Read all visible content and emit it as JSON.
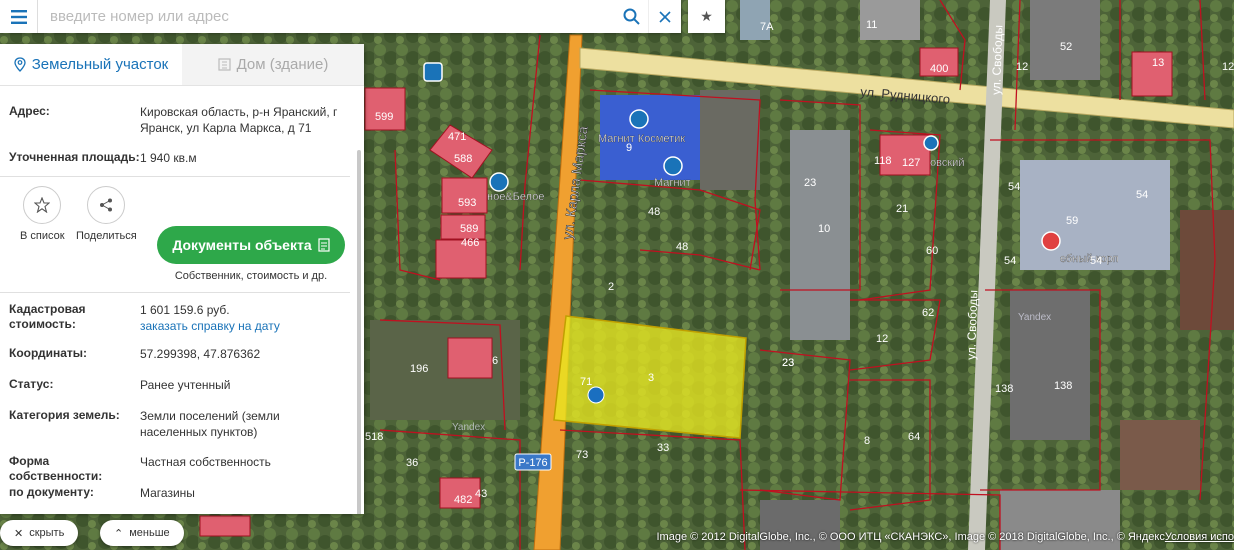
{
  "search": {
    "placeholder": "введите номер или адрес"
  },
  "tabs": [
    {
      "label": "Земельный участок",
      "icon": "map-pin-icon",
      "active": true
    },
    {
      "label": "Дом (здание)",
      "icon": "building-icon",
      "active": false
    }
  ],
  "info": {
    "address_label": "Адрес:",
    "address_value": "Кировская область, р-н Яранский, г Яранск, ул Карла Маркса, д 71",
    "area_label": "Уточненная площадь:",
    "area_value": "1 940 кв.м",
    "cost_label": "Кадастровая стоимость:",
    "cost_value": "1 601 159.6 руб.",
    "cost_link": "заказать справку на дату",
    "coords_label": "Координаты:",
    "coords_value": "57.299398, 47.876362",
    "status_label": "Статус:",
    "status_value": "Ранее учтенный",
    "category_label": "Категория земель:",
    "category_value": "Земли поселений (земли населенных пунктов)",
    "ownership_label": "Форма собственности:",
    "ownership_value": "Частная собственность",
    "doc_label": "по документу:",
    "doc_value": "Магазины"
  },
  "actions": {
    "favorite_label": "В список",
    "share_label": "Поделиться",
    "docs_label": "Документы объекта",
    "docs_sub": "Собственник, стоимость и др."
  },
  "bottom": {
    "hide_label": "скрыть",
    "less_label": "меньше"
  },
  "map": {
    "streets": [
      "ул. Карла Маркса",
      "ул. Рудницкого",
      "ул. Свободы",
      "ул. Свободы"
    ],
    "road_badge": "Р-176",
    "pois": [
      "Магнит Косметик",
      "Магнит",
      "ное&Белое",
      "ебный корп",
      "овский"
    ],
    "parcel_labels": [
      "7А",
      "11",
      "400",
      "12",
      "13",
      "52",
      "12",
      "599",
      "471",
      "588",
      "593",
      "589",
      "466",
      "9",
      "118",
      "127",
      "23",
      "48",
      "48",
      "10",
      "21",
      "54",
      "54",
      "59",
      "54",
      "54",
      "2",
      "60",
      "62",
      "12",
      "23",
      "71",
      "3",
      "196",
      "6",
      "138",
      "138",
      "23",
      "8",
      "64",
      "36",
      "33",
      "73",
      "43",
      "482",
      "518"
    ],
    "attribution_a": "Image © 2012 DigitalGlobe, Inc., © ООО ИТЦ «СКАНЭКС», Image © 2018 DigitalGlobe, Inc., © Яндекс ",
    "attribution_b": "Условия испо",
    "watermarks": [
      "Yandex",
      "Yandex",
      "Yandex"
    ]
  }
}
